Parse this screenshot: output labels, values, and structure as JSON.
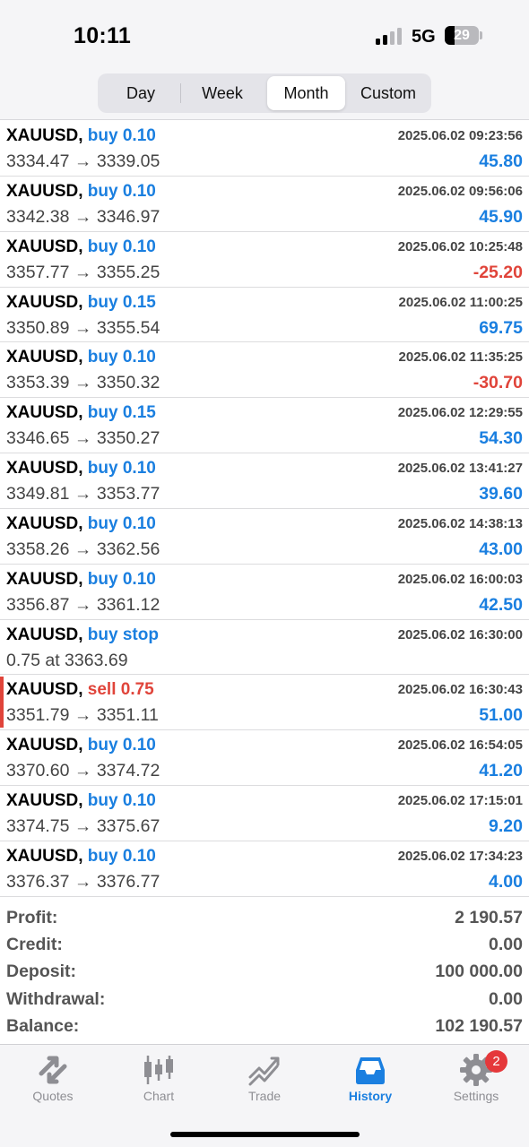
{
  "status_bar": {
    "time": "10:11",
    "network": "5G",
    "battery_level": "29",
    "battery_fraction": 0.29
  },
  "period_tabs": [
    {
      "label": "Day",
      "active": false
    },
    {
      "label": "Week",
      "active": false
    },
    {
      "label": "Month",
      "active": true
    },
    {
      "label": "Custom",
      "active": false
    }
  ],
  "trades": [
    {
      "symbol": "XAUUSD,",
      "side": "buy 0.10",
      "direction": "buy",
      "time": "2025.06.02 09:23:56",
      "prices": "3334.47 → 3339.05",
      "profit": "45.80",
      "profit_sign": "pos",
      "marked": false
    },
    {
      "symbol": "XAUUSD,",
      "side": "buy 0.10",
      "direction": "buy",
      "time": "2025.06.02 09:56:06",
      "prices": "3342.38 → 3346.97",
      "profit": "45.90",
      "profit_sign": "pos",
      "marked": false
    },
    {
      "symbol": "XAUUSD,",
      "side": "buy 0.10",
      "direction": "buy",
      "time": "2025.06.02 10:25:48",
      "prices": "3357.77 → 3355.25",
      "profit": "-25.20",
      "profit_sign": "neg",
      "marked": false
    },
    {
      "symbol": "XAUUSD,",
      "side": "buy 0.15",
      "direction": "buy",
      "time": "2025.06.02 11:00:25",
      "prices": "3350.89 → 3355.54",
      "profit": "69.75",
      "profit_sign": "pos",
      "marked": false
    },
    {
      "symbol": "XAUUSD,",
      "side": "buy 0.10",
      "direction": "buy",
      "time": "2025.06.02 11:35:25",
      "prices": "3353.39 → 3350.32",
      "profit": "-30.70",
      "profit_sign": "neg",
      "marked": false
    },
    {
      "symbol": "XAUUSD,",
      "side": "buy 0.15",
      "direction": "buy",
      "time": "2025.06.02 12:29:55",
      "prices": "3346.65 → 3350.27",
      "profit": "54.30",
      "profit_sign": "pos",
      "marked": false
    },
    {
      "symbol": "XAUUSD,",
      "side": "buy 0.10",
      "direction": "buy",
      "time": "2025.06.02 13:41:27",
      "prices": "3349.81 → 3353.77",
      "profit": "39.60",
      "profit_sign": "pos",
      "marked": false
    },
    {
      "symbol": "XAUUSD,",
      "side": "buy 0.10",
      "direction": "buy",
      "time": "2025.06.02 14:38:13",
      "prices": "3358.26 → 3362.56",
      "profit": "43.00",
      "profit_sign": "pos",
      "marked": false
    },
    {
      "symbol": "XAUUSD,",
      "side": "buy 0.10",
      "direction": "buy",
      "time": "2025.06.02 16:00:03",
      "prices": "3356.87 → 3361.12",
      "profit": "42.50",
      "profit_sign": "pos",
      "marked": false
    },
    {
      "symbol": "XAUUSD,",
      "side": "buy stop",
      "direction": "buy",
      "time": "2025.06.02 16:30:00",
      "prices": "0.75 at 3363.69",
      "profit": "",
      "profit_sign": "pos",
      "marked": false
    },
    {
      "symbol": "XAUUSD,",
      "side": "sell 0.75",
      "direction": "sell",
      "time": "2025.06.02 16:30:43",
      "prices": "3351.79 → 3351.11",
      "profit": "51.00",
      "profit_sign": "pos",
      "marked": true
    },
    {
      "symbol": "XAUUSD,",
      "side": "buy 0.10",
      "direction": "buy",
      "time": "2025.06.02 16:54:05",
      "prices": "3370.60 → 3374.72",
      "profit": "41.20",
      "profit_sign": "pos",
      "marked": false
    },
    {
      "symbol": "XAUUSD,",
      "side": "buy 0.10",
      "direction": "buy",
      "time": "2025.06.02 17:15:01",
      "prices": "3374.75 → 3375.67",
      "profit": "9.20",
      "profit_sign": "pos",
      "marked": false
    },
    {
      "symbol": "XAUUSD,",
      "side": "buy 0.10",
      "direction": "buy",
      "time": "2025.06.02 17:34:23",
      "prices": "3376.37 → 3376.77",
      "profit": "4.00",
      "profit_sign": "pos",
      "marked": false
    }
  ],
  "summary": {
    "profit_label": "Profit:",
    "profit_value": "2 190.57",
    "credit_label": "Credit:",
    "credit_value": "0.00",
    "deposit_label": "Deposit:",
    "deposit_value": "100 000.00",
    "withdrawal_label": "Withdrawal:",
    "withdrawal_value": "0.00",
    "balance_label": "Balance:",
    "balance_value": "102 190.57"
  },
  "tab_bar": {
    "quotes": {
      "label": "Quotes",
      "icon": "arrows-diagonal-icon"
    },
    "chart": {
      "label": "Chart",
      "icon": "candlestick-icon"
    },
    "trade": {
      "label": "Trade",
      "icon": "trend-lines-icon"
    },
    "history": {
      "label": "History",
      "icon": "inbox-tray-icon",
      "active": true
    },
    "settings": {
      "label": "Settings",
      "icon": "gear-icon",
      "badge": "2"
    }
  },
  "colors": {
    "accent": "#1a7fe0",
    "negative": "#e0443a",
    "badge": "#e5383b"
  }
}
